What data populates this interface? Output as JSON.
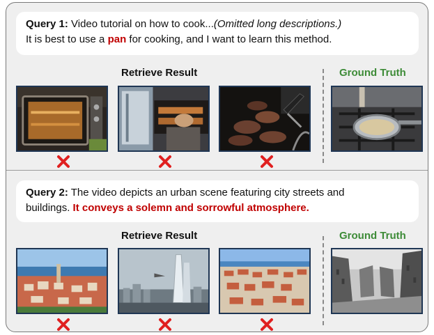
{
  "query1": {
    "label": "Query 1:",
    "line1_text": " Video tutorial on how to cook...",
    "line1_italic": "(Omitted long descriptions.)",
    "line2_pre": "It is best to use a ",
    "line2_highlight": "pan",
    "line2_post": " for cooking, and I want to learn this method."
  },
  "query2": {
    "label": "Query 2:",
    "line1_text": " The video depicts an urban scene featuring city streets and",
    "line2_pre": "buildings. ",
    "line2_highlight": "It conveys a solemn and sorrowful atmosphere."
  },
  "labels": {
    "retrieve_result": "Retrieve Result",
    "ground_truth": "Ground Truth"
  },
  "colors": {
    "highlight": "#c00000",
    "ground_truth": "#3d8b37",
    "wrong_mark": "#e02020",
    "thumb_border": "#1f3654"
  },
  "icons": {
    "wrong": "red-cross-icon"
  },
  "panel1_images": {
    "retrieved": [
      "oven interior",
      "oven with tray",
      "grilling meat"
    ],
    "ground_truth": "frying pan on stove"
  },
  "panel2_images": {
    "retrieved": [
      "coastal old town",
      "futuristic city skyline",
      "aerial city view"
    ],
    "ground_truth": "ruined city street"
  }
}
